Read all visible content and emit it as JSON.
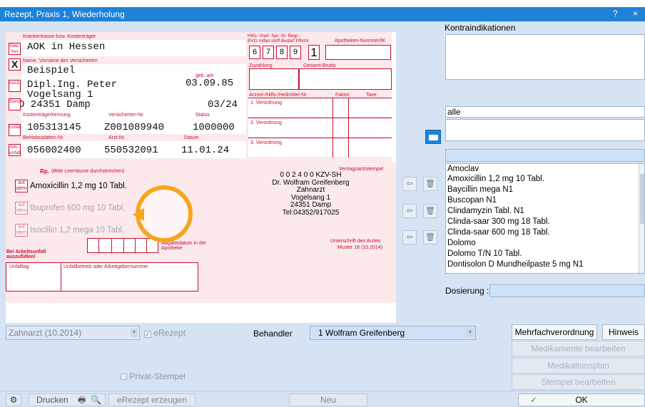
{
  "window": {
    "title": "Rezept, Praxis 1, Wiederholung",
    "help": "?",
    "close": "×"
  },
  "form": {
    "kasse_label": "Krankenkasse bzw. Kostenträger",
    "kasse": "AOK in Hessen",
    "name_label": "Name, Vorname des Versicherten",
    "name1": "Beispiel",
    "name2": "Dipl.Ing. Peter",
    "geb_label": "geb. am",
    "geb": "03.09.85",
    "street": "Vogelsang 1",
    "city": "D 24351 Damp",
    "date_short": "03/24",
    "ktk_label": "Kostenträgerkennung",
    "versnr_label": "Versicherten-Nr.",
    "status_label": "Status",
    "ktk": "105313145",
    "versnr": "Z001089940",
    "status": "1000000",
    "bsnr_label": "Betriebsstätten-Nr.",
    "arztnr_label": "Arzt-Nr.",
    "datum_label": "Datum",
    "bsnr": "056002400",
    "arztnr": "550532091",
    "datum": "11.01.24",
    "side_geb": "Geb. frei",
    "side_sonstige": "Sonst.",
    "side_noctu": "noctu",
    "side_unfall": "Unfall",
    "side_arbunfall": "Arb.-unfall",
    "side_x": "X",
    "hilfs_header": "Hilfs- Impf- Spr.-St. Begr.-",
    "hilfs_sub": "BVG mittel stoff Bedarf Pflicht",
    "apo_label": "Apotheken-Nummer/IK",
    "n6": "6",
    "n7": "7",
    "n8": "8",
    "n9": "9",
    "n1": "1",
    "zuzahlung": "Zuzahlung",
    "gesamt": "Gesamt-Brutto",
    "arznei": "Arznei-/Hilfs-/Heilmittel-Nr.",
    "faktor": "Faktor",
    "taxe": "Taxe",
    "vo1": "1. Verordnung",
    "vo2": "2. Verordnung",
    "vo3": "3. Verordnung",
    "rp": "Rp.",
    "rp_hint": "(Bitte Leerräume durchstreichen)",
    "aut_idem": "aut idem",
    "med1": "Amoxicillin 1,2 mg 10 Tabl.",
    "med2": "Ibuprofen 600 mg 10 Tabl.",
    "med3": "Isocillin 1,2 mega 10 Tabl.",
    "stempel_label": "Vertragsarztstempel",
    "stamp1": "0 0 2 4 0 0 KZV-SH",
    "stamp2": "Dr. Wolfram Greifenberg",
    "stamp3": "Zahnarzt",
    "stamp4": "Vogelsang 1",
    "stamp5": "24351 Damp",
    "stamp6": "Tel:04352/917025",
    "abgabe": "Abgabedatum in der Apotheke",
    "unterschrift": "Unterschrift des Arztes",
    "muster": "Muster 16 (10.2014)",
    "arbeitsunfall": "Bei Arbeitsunfall auszufüllen!",
    "unfalltag": "Unfalltag",
    "unfallbetrieb": "Unfallbetrieb oder Arbeitgebernummer"
  },
  "right": {
    "kontra_label": "Kontraindikationen",
    "filter": "alle",
    "list": [
      "Amoclav",
      "Amoxicillin 1,2 mg 10 Tabl.",
      "Baycillin mega N1",
      "Buscopan N1",
      "Clindamyzin Tabl. N1",
      "Clinda-saar 300 mg 18 Tabl.",
      "Clinda-saar 600 mg 18 Tabl.",
      "Dolomo",
      "Dolomo T/N 10 Tabl.",
      "Dontisolon D Mundheilpaste 5 mg N1"
    ],
    "dosierung": "Dosierung :"
  },
  "bottom": {
    "form_select": "Zahnarzt (10.2014)",
    "erezept": "eRezept",
    "behandler_label": "Behandler",
    "behandler": "1 Wolfram Greifenberg",
    "privat": "Privat-Stempel",
    "mehrfach": "Mehrfachverordnung",
    "hinweis": "Hinweis",
    "med_bearb": "Medikamente bearbeiten",
    "medplan": "Medikationsplan",
    "stempel_bearb": "Stempel bearbeiten"
  },
  "footer": {
    "drucken": "Drucken",
    "erezept_erzeugen": "eRezept erzeugen",
    "neu": "Neu",
    "ok": "OK"
  }
}
